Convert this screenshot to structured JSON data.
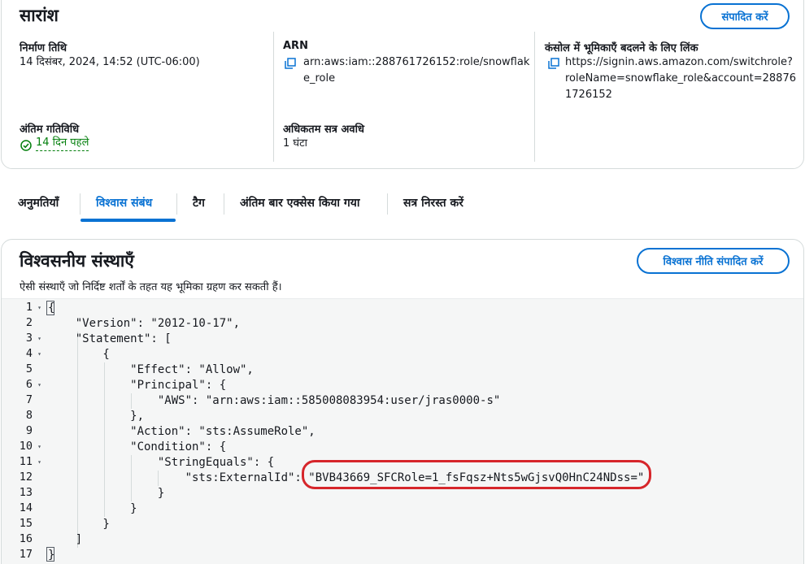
{
  "summary": {
    "title": "सारांश",
    "edit_button": "संपादित करें",
    "creation_date_label": "निर्माण तिथि",
    "creation_date_value": "14 दिसंबर, 2024, 14:52 (UTC-06:00)",
    "arn_label": "ARN",
    "arn_line1": "arn:aws:iam::288761726152:role/snowflak",
    "arn_line2": "e_role",
    "switch_link_label": "कंसोल में भूमिकाएँ बदलने के लिए लिंक",
    "switch_link_line1": "https://signin.aws.amazon.com/switchrole?",
    "switch_link_line2": "roleName=snowflake_role&account=28876",
    "switch_link_line3": "1726152",
    "last_activity_label": "अंतिम गतिविधि",
    "last_activity_value": "14 दिन पहले",
    "max_session_label": "अधिकतम सत्र अवधि",
    "max_session_value": "1 घंटा"
  },
  "tabs": [
    {
      "label": "अनुमतियाँ"
    },
    {
      "label": "विश्वास संबंध",
      "active": true
    },
    {
      "label": "टैग"
    },
    {
      "label": "अंतिम बार एक्सेस किया गया"
    },
    {
      "label": "सत्र निरस्त करें"
    }
  ],
  "trust": {
    "title": "विश्वसनीय संस्थाएँ",
    "edit_button": "विश्वास नीति संपादित करें",
    "description": "ऐसी संस्थाएँ जो निर्दिष्ट शर्तों के तहत यह भूमिका ग्रहण कर सकती हैं।"
  },
  "editor": {
    "line_numbers": [
      "1",
      "2",
      "3",
      "4",
      "5",
      "6",
      "7",
      "8",
      "9",
      "10",
      "11",
      "12",
      "13",
      "14",
      "15",
      "16",
      "17"
    ],
    "foldable": [
      true,
      false,
      true,
      true,
      false,
      true,
      false,
      false,
      false,
      true,
      true,
      false,
      false,
      false,
      false,
      false,
      false
    ],
    "lines": [
      "{",
      "    \"Version\": \"2012-10-17\",",
      "    \"Statement\": [",
      "        {",
      "            \"Effect\": \"Allow\",",
      "            \"Principal\": {",
      "                \"AWS\": \"arn:aws:iam::585008083954:user/jras0000-s\"",
      "            },",
      "            \"Action\": \"sts:AssumeRole\",",
      "            \"Condition\": {",
      "                \"StringEquals\": {",
      "                    \"sts:ExternalId\": \"BVB43669_SFCRole=1_fsFqsz+Nts5wGjsvQ0HnC24NDss=\"",
      "                }",
      "            }",
      "        }",
      "    ]",
      "}"
    ]
  },
  "colors": {
    "accent": "#0972d3",
    "highlight": "#d6262b",
    "success": "#037f0c"
  }
}
